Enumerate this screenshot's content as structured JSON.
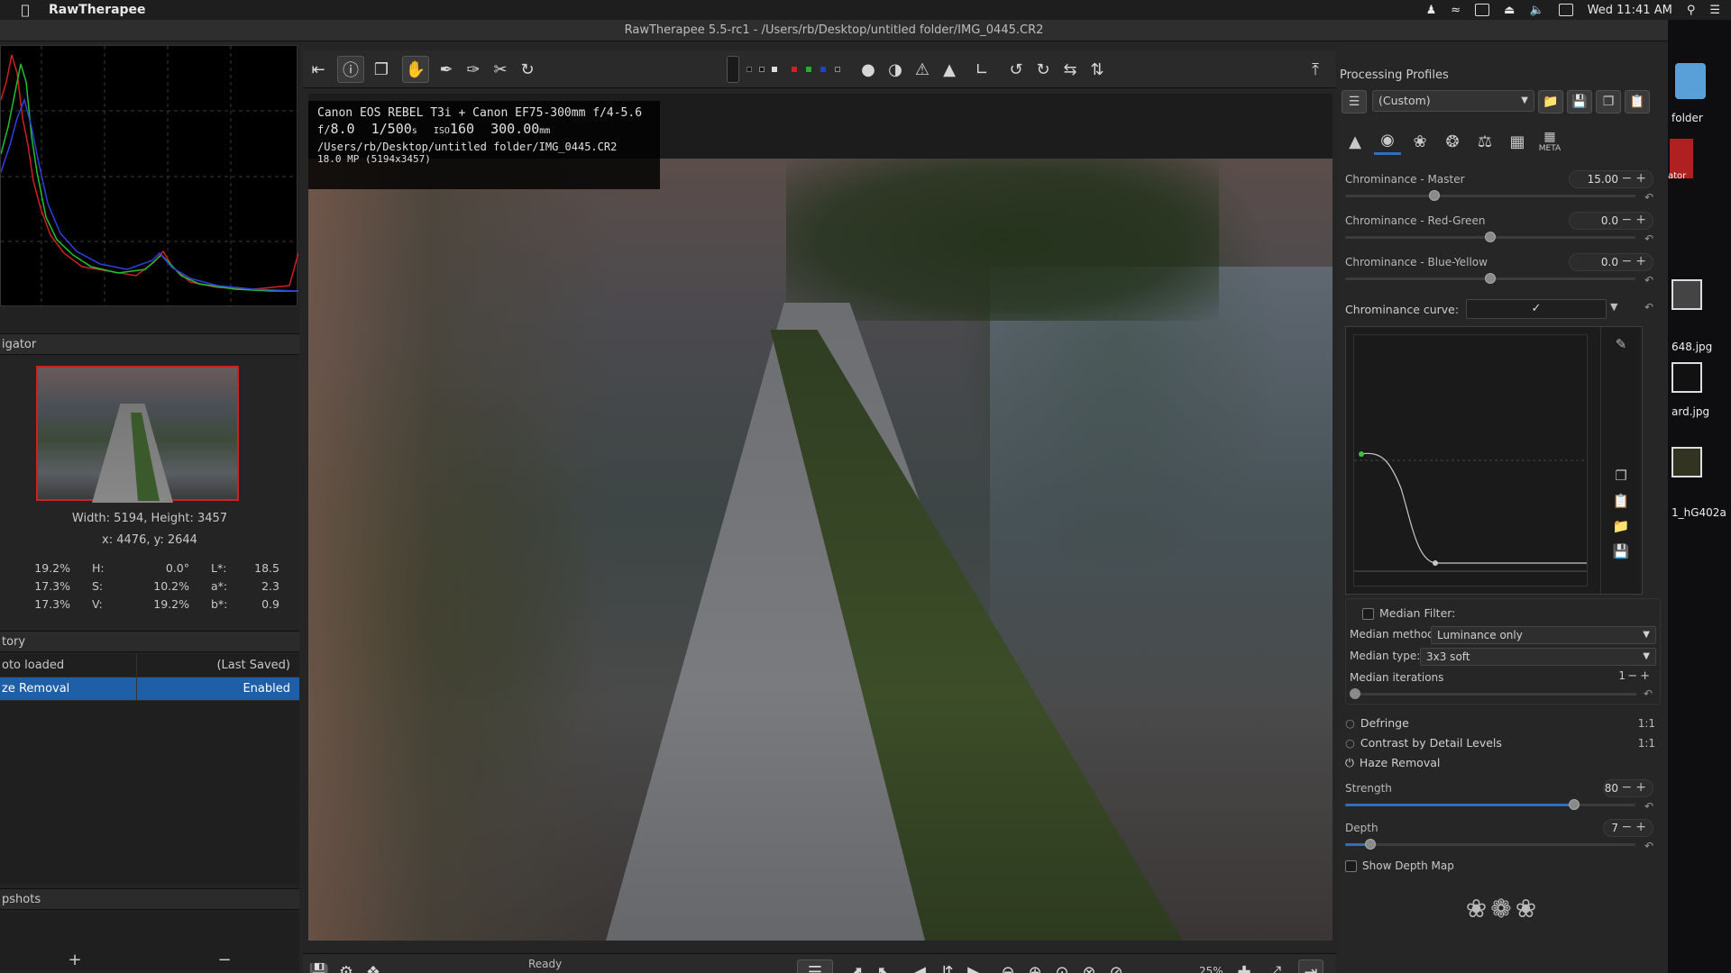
{
  "menubar": {
    "app_name": "RawTherapee",
    "clock": "Wed 11:41 AM"
  },
  "window": {
    "title": "RawTherapee 5.5-rc1 - /Users/rb/Desktop/untitled folder/IMG_0445.CR2"
  },
  "left": {
    "navigator_title": "igator",
    "nav_size": "Width: 5194, Height: 3457",
    "nav_xy": "x: 4476, y: 2644",
    "nav_rows": [
      {
        "a": "19.2%",
        "b": "H:",
        "c": "0.0°",
        "d": "L*:",
        "e": "18.5"
      },
      {
        "a": "17.3%",
        "b": "S:",
        "c": "10.2%",
        "d": "a*:",
        "e": "2.3"
      },
      {
        "a": "17.3%",
        "b": "V:",
        "c": "19.2%",
        "d": "b*:",
        "e": "0.9"
      }
    ],
    "history_title": "tory",
    "history": [
      {
        "a": "oto loaded",
        "b": "(Last Saved)"
      },
      {
        "a": "ze Removal",
        "b": "Enabled"
      }
    ],
    "snapshots_title": "pshots",
    "snap_add": "+",
    "snap_remove": "−"
  },
  "exif": {
    "camera": "Canon EOS REBEL T3i + Canon EF75-300mm f/4-5.6",
    "f": "f/",
    "aperture": "8.0",
    "shutter": "1/500",
    "shutter_unit": "s",
    "iso_label": "ISO",
    "iso": "160",
    "focal": "300.00",
    "focal_unit": "mm",
    "path": "/Users/rb/Desktop/untitled folder/IMG_0445.CR2",
    "mp": "18.0 MP (5194x3457)"
  },
  "bottom": {
    "status": "Ready",
    "zoom": "25%"
  },
  "right": {
    "pp_title": "Processing Profiles",
    "pp_value": "(Custom)",
    "sliders": [
      {
        "label": "Chrominance - Master",
        "value": "15.00",
        "pct": 0.3
      },
      {
        "label": "Chrominance - Red-Green",
        "value": "0.0",
        "pct": 0.5
      },
      {
        "label": "Chrominance - Blue-Yellow",
        "value": "0.0",
        "pct": 0.5
      }
    ],
    "curve_label": "Chrominance curve:",
    "median_filter": "Median Filter:",
    "median_method_label": "Median method:",
    "median_method": "Luminance only",
    "median_type_label": "Median type:",
    "median_type": "3x3 soft",
    "median_iter_label": "Median iterations",
    "median_iter": "1",
    "defringe": "Defringe",
    "cbdl": "Contrast by Detail Levels",
    "ratio": "1:1",
    "haze": "Haze Removal",
    "strength_label": "Strength",
    "strength": "80",
    "strength_pct": 0.8,
    "depth_label": "Depth",
    "depth": "7",
    "depth_pct": 0.07,
    "show_depth": "Show Depth Map",
    "meta_tab": "META"
  },
  "desktop": {
    "folder": "folder",
    "item1": "648.jpg",
    "item2": "ard.jpg",
    "item3": "1_hG402a",
    "ator": "ator"
  },
  "colors": {
    "accent": "#2f6fbf",
    "selection": "#1f5fa8"
  }
}
